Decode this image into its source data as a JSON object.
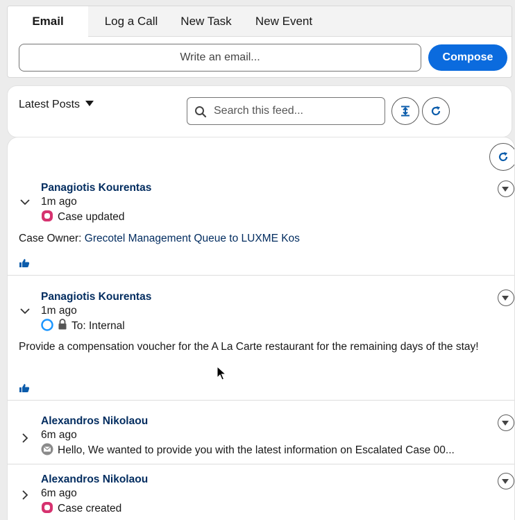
{
  "publisher": {
    "tabs": [
      {
        "label": "Email",
        "active": true
      },
      {
        "label": "Log a Call",
        "active": false
      },
      {
        "label": "New Task",
        "active": false
      },
      {
        "label": "New Event",
        "active": false
      }
    ],
    "email_placeholder": "Write an email...",
    "compose_label": "Compose"
  },
  "feed_toolbar": {
    "sort_label": "Latest Posts",
    "search_placeholder": "Search this feed..."
  },
  "posts": [
    {
      "author": "Panagiotis Kourentas",
      "time": "1m ago",
      "type_icon": "case-updated-icon",
      "meta": "Case updated",
      "body_label": "Case Owner: ",
      "body_link": "Grecotel Management Queue to LUXME Kos"
    },
    {
      "author": "Panagiotis Kourentas",
      "time": "1m ago",
      "type_icon": "internal-post-icon",
      "meta": "To: Internal",
      "body": "Provide a compensation voucher for the A La Carte restaurant for the remaining days of the stay!"
    },
    {
      "author": "Alexandros Nikolaou",
      "time": "6m ago",
      "type_icon": "email-icon",
      "meta": "Hello, We wanted to provide you with the latest information on Escalated Case 00..."
    },
    {
      "author": "Alexandros Nikolaou",
      "time": "6m ago",
      "type_icon": "case-created-icon",
      "meta": "Case created"
    }
  ],
  "colors": {
    "brand": "#0b6bde",
    "link": "#032d60",
    "case_icon": "#d6326f",
    "internal_icon": "#1b96ff"
  }
}
